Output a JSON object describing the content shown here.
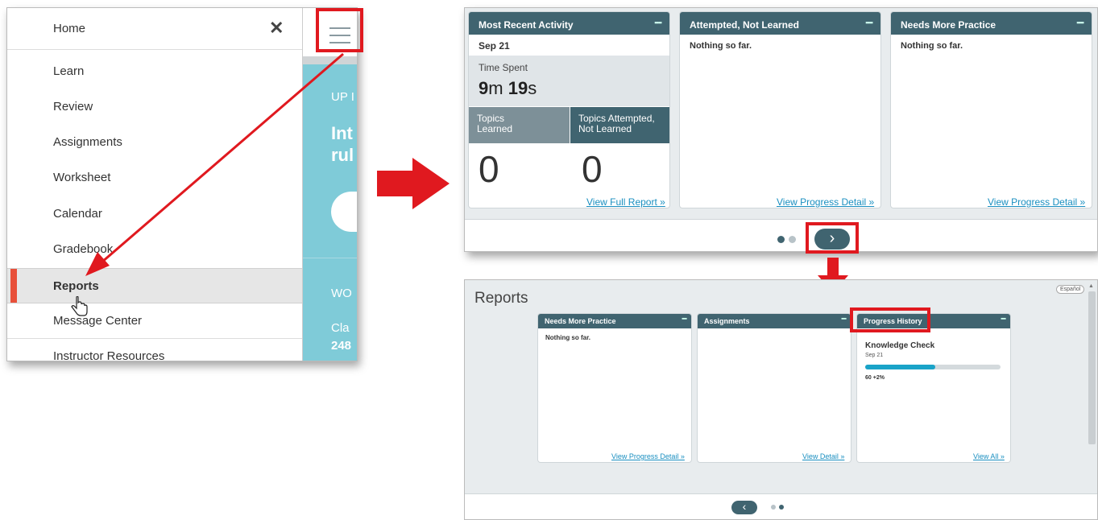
{
  "menu": {
    "home_label": "Home",
    "close_glyph": "✕",
    "items": [
      {
        "label": "Learn"
      },
      {
        "label": "Review"
      },
      {
        "label": "Assignments"
      },
      {
        "label": "Worksheet"
      },
      {
        "label": "Calendar"
      },
      {
        "label": "Gradebook"
      },
      {
        "label": "Reports",
        "active": true
      },
      {
        "label": "Message Center"
      },
      {
        "label": "Instructor Resources"
      }
    ]
  },
  "background_strip": {
    "up_text": "UP I",
    "big_line1": "Int",
    "big_line2": "rul",
    "wo_text": "WO",
    "cla_text": "Cla",
    "num_text": "248"
  },
  "dashboard": {
    "cards": [
      {
        "header": "Most Recent Activity",
        "date": "Sep 21",
        "time_spent_label": "Time Spent",
        "time_min": "9",
        "time_min_unit": "m",
        "time_sec": "19",
        "time_sec_unit": "s",
        "tile1_label": "Topics Learned",
        "tile2_label": "Topics Attempted, Not Learned",
        "tile1_value": "0",
        "tile2_value": "0",
        "link": "View Full Report »"
      },
      {
        "header": "Attempted, Not Learned",
        "body": "Nothing so far.",
        "link": "View Progress Detail »"
      },
      {
        "header": "Needs More Practice",
        "body": "Nothing so far.",
        "link": "View Progress Detail »"
      }
    ],
    "next_glyph": "›"
  },
  "reports": {
    "title": "Reports",
    "language_button": "Español",
    "cards": [
      {
        "header": "Needs More Practice",
        "body": "Nothing so far.",
        "link": "View Progress Detail »"
      },
      {
        "header": "Assignments",
        "body": "",
        "link": "View Detail »"
      },
      {
        "header": "Progress History",
        "item_title": "Knowledge Check",
        "item_date": "Sep 21",
        "progress_fraction": 0.52,
        "score_text": "60 +2%",
        "link": "View All »"
      }
    ],
    "prev_glyph": "‹"
  },
  "colors": {
    "header_teal": "#406470",
    "highlight_red": "#e0191f",
    "active_bar": "#e8503a",
    "link_blue": "#1a8fc0",
    "progress_fill": "#1aa3c8"
  }
}
